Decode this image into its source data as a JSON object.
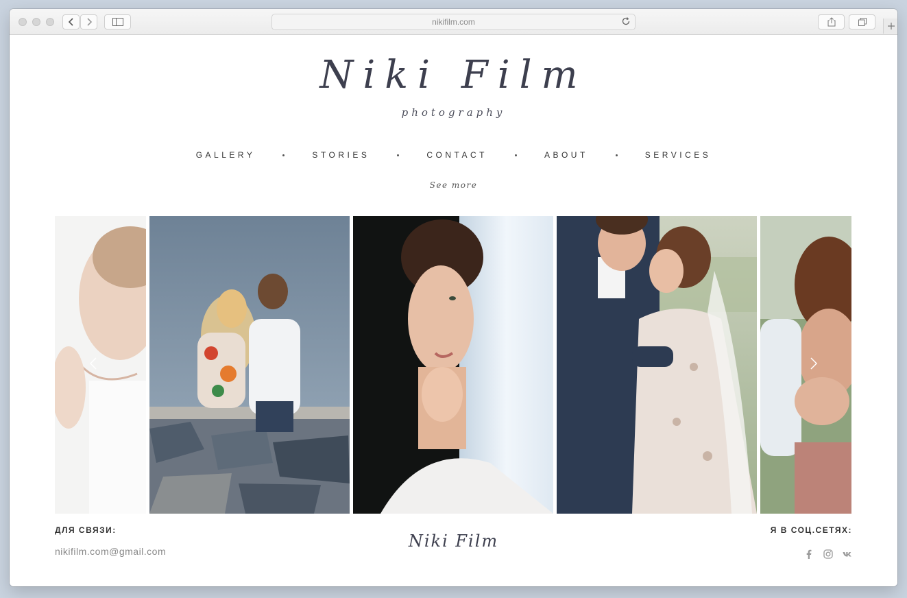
{
  "browser": {
    "url": "nikifilm.com"
  },
  "site": {
    "logo_main": "Niki Film",
    "logo_sub": "photography"
  },
  "nav": {
    "items": [
      "GALLERY",
      "STORIES",
      "CONTACT",
      "ABOUT",
      "SERVICES"
    ]
  },
  "see_more": "See more",
  "gallery": {
    "photos": [
      {
        "subject": "couple-kiss-closeup"
      },
      {
        "subject": "couple-sitting-by-water"
      },
      {
        "subject": "bride-portrait"
      },
      {
        "subject": "wedding-couple-embrace"
      },
      {
        "subject": "woman-hugging"
      }
    ]
  },
  "footer": {
    "contact_heading": "ДЛЯ СВЯЗИ:",
    "email": "nikifilm.com@gmail.com",
    "logo": "Niki Film",
    "social_heading": "Я В СОЦ.СЕТЯХ:"
  },
  "icons": {
    "social": [
      "facebook-icon",
      "instagram-icon",
      "vk-icon"
    ]
  }
}
